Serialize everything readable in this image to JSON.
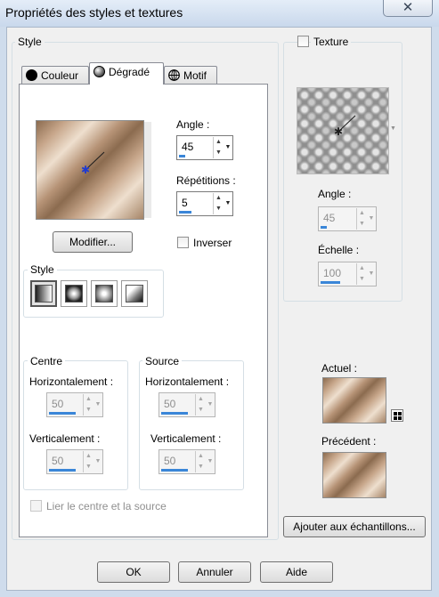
{
  "window": {
    "title": "Propriétés des styles et textures",
    "close_glyph": "✕"
  },
  "style_group": {
    "label": "Style",
    "tabs": [
      {
        "label": "Couleur",
        "icon": "black-circle-icon"
      },
      {
        "label": "Dégradé",
        "icon": "gradient-circle-icon"
      },
      {
        "label": "Motif",
        "icon": "globe-grid-icon"
      }
    ],
    "active_tab": "Dégradé",
    "angle": {
      "label": "Angle :",
      "value": "45"
    },
    "repetitions": {
      "label": "Répétitions :",
      "value": "5"
    },
    "invert_label": "Inverser",
    "modify_button": "Modifier...",
    "gradient_style": {
      "label": "Style",
      "icons": [
        "linear-gradient-icon",
        "rectangular-gradient-icon",
        "radial-gradient-icon",
        "corner-gradient-icon"
      ],
      "selected_index": 0
    },
    "center": {
      "label": "Centre",
      "horizontal_label": "Horizontalement :",
      "horizontal_value": "50",
      "vertical_label": "Verticalement :",
      "vertical_value": "50"
    },
    "source": {
      "label": "Source",
      "horizontal_label": "Horizontalement :",
      "horizontal_value": "50",
      "vertical_label": "Verticalement :",
      "vertical_value": "50"
    },
    "link_label": "Lier le centre et la source"
  },
  "texture_group": {
    "label": "Texture",
    "angle": {
      "label": "Angle :",
      "value": "45"
    },
    "scale": {
      "label": "Échelle :",
      "value": "100"
    }
  },
  "current_label": "Actuel :",
  "previous_label": "Précédent :",
  "add_swatch_button": "Ajouter aux échantillons...",
  "footer": {
    "ok": "OK",
    "cancel": "Annuler",
    "help": "Aide"
  },
  "colors": {
    "accent": "#3a86d8",
    "gradient_dark": "#8b6b4f",
    "gradient_light": "#eedfce"
  }
}
